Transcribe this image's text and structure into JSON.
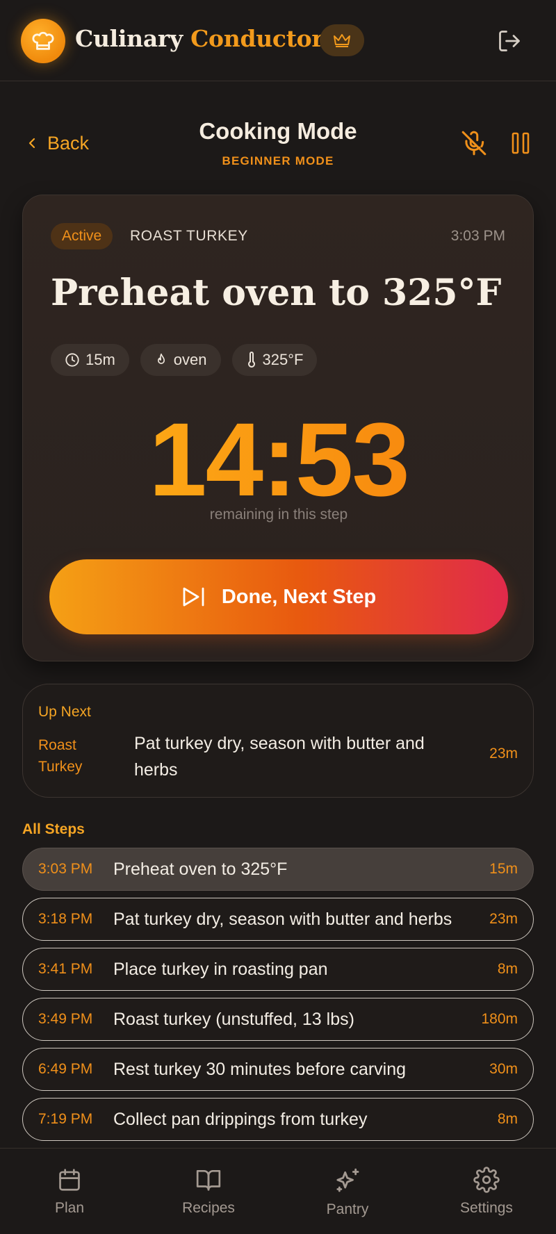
{
  "header": {
    "title_part1": "Culinary",
    "title_part2": "Conductor",
    "logo_icon": "chef-hat-icon",
    "premium_icon": "crown-icon",
    "logout_icon": "logout-icon"
  },
  "subheader": {
    "back_label": "Back",
    "title": "Cooking Mode",
    "subtitle": "BEGINNER MODE"
  },
  "active_step": {
    "status": "Active",
    "recipe": "ROAST TURKEY",
    "time": "3:03 PM",
    "title": "Preheat oven to 325°F",
    "chips": [
      {
        "icon": "clock-icon",
        "label": "15m"
      },
      {
        "icon": "flame-icon",
        "label": "oven"
      },
      {
        "icon": "thermometer-icon",
        "label": "325°F"
      }
    ],
    "timer": "14:53",
    "timer_caption": "remaining in this step",
    "next_button": "Done, Next Step"
  },
  "up_next": {
    "label": "Up Next",
    "recipe": "Roast Turkey",
    "text": "Pat turkey dry, season with butter and herbs",
    "duration": "23m"
  },
  "all_steps": {
    "label": "All Steps",
    "items": [
      {
        "time": "3:03 PM",
        "text": "Preheat oven to 325°F",
        "duration": "15m"
      },
      {
        "time": "3:18 PM",
        "text": "Pat turkey dry, season with butter and herbs",
        "duration": "23m"
      },
      {
        "time": "3:41 PM",
        "text": "Place turkey in roasting pan",
        "duration": "8m"
      },
      {
        "time": "3:49 PM",
        "text": "Roast turkey (unstuffed, 13 lbs)",
        "duration": "180m"
      },
      {
        "time": "6:49 PM",
        "text": "Rest turkey 30 minutes before carving",
        "duration": "30m"
      },
      {
        "time": "7:19 PM",
        "text": "Collect pan drippings from turkey",
        "duration": "8m"
      }
    ]
  },
  "nav": [
    {
      "label": "Plan",
      "icon": "calendar-icon"
    },
    {
      "label": "Recipes",
      "icon": "book-icon"
    },
    {
      "label": "Pantry",
      "icon": "sparkle-icon"
    },
    {
      "label": "Settings",
      "icon": "gear-icon"
    }
  ],
  "colors": {
    "accent": "#f0901a",
    "background": "#1c1918",
    "button_gradient_start": "#f5a015",
    "button_gradient_end": "#e02a4b"
  }
}
